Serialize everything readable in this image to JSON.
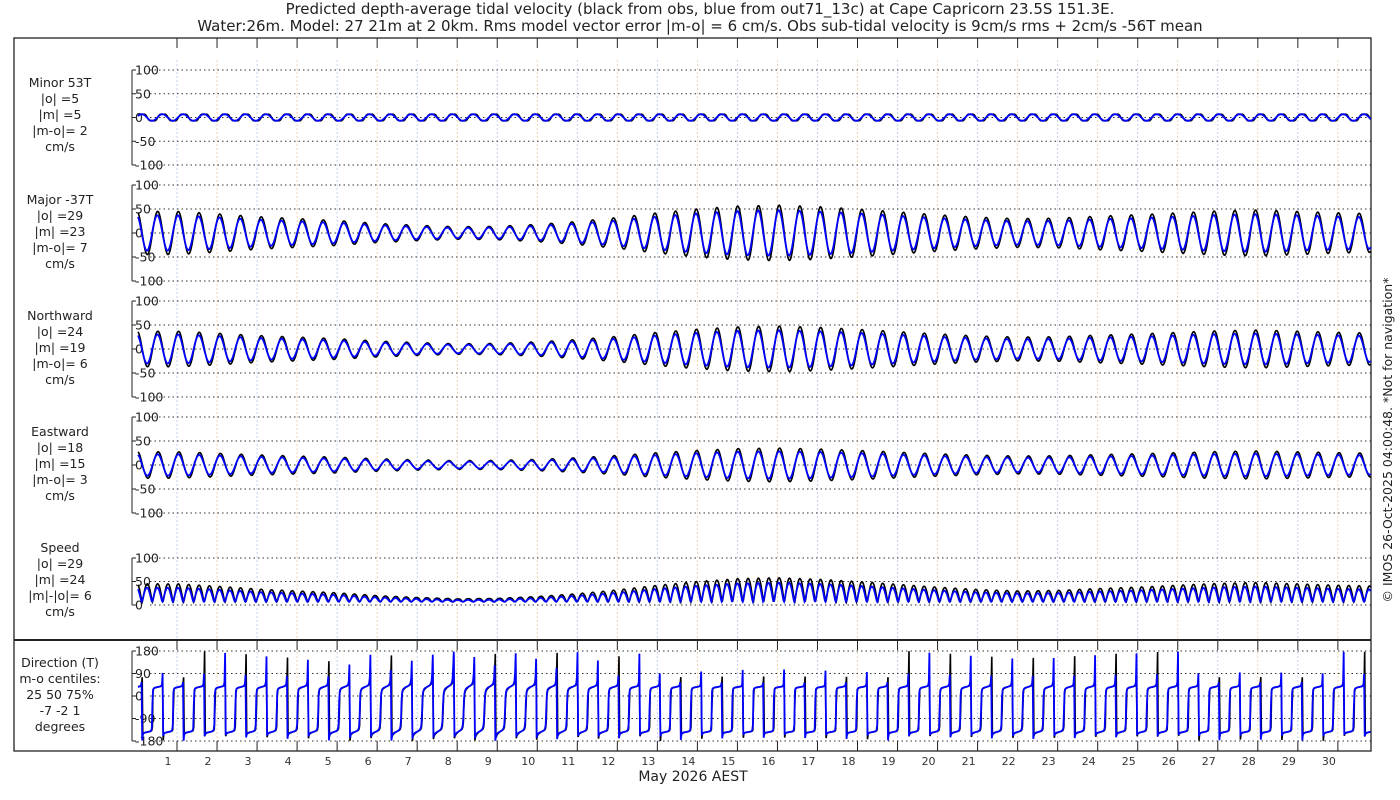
{
  "title": {
    "line1": "Predicted depth-average tidal velocity (black from obs, blue from out71_13c) at Cape Capricorn 23.5S 151.3E.",
    "line2": "Water:26m. Model: 27 21m at 2 0km. Rms model vector error |m-o| = 6 cm/s. Obs sub-tidal velocity is 9cm/s rms + 2cm/s -56T mean"
  },
  "copyright": "© IMOS 26-Oct-2025 04:00:48. *Not for navigation*",
  "colors": {
    "obs": "#000000",
    "model": "#0000ff"
  },
  "chart_data": {
    "type": "line",
    "xlabel": "May 2026 AEST",
    "x_ticks": [
      "1",
      "2",
      "3",
      "4",
      "5",
      "6",
      "7",
      "8",
      "9",
      "10",
      "11",
      "12",
      "13",
      "14",
      "15",
      "16",
      "17",
      "18",
      "19",
      "20",
      "21",
      "22",
      "23",
      "24",
      "25",
      "26",
      "27",
      "28",
      "29",
      "30"
    ],
    "x_range_days": [
      0.03,
      31.85
    ],
    "grid": true,
    "legend": "in title: black from obs, blue from out71_13c",
    "major_amplitude_by_day": [
      45,
      45,
      40,
      34,
      30,
      26,
      20,
      16,
      13,
      14,
      18,
      24,
      32,
      42,
      50,
      56,
      58,
      55,
      50,
      44,
      38,
      33,
      30,
      31,
      35,
      38,
      42,
      46,
      48,
      45,
      42,
      40
    ],
    "model_to_obs_ratio": 0.82,
    "panels": [
      {
        "name": "minor",
        "label": [
          "Minor 53T",
          "|o| =5",
          "|m| =5",
          "|m-o|= 2",
          "cm/s"
        ],
        "yticks": [
          "100",
          "50",
          "0",
          "-50",
          "-100"
        ],
        "ylim": [
          -100,
          100
        ]
      },
      {
        "name": "major",
        "label": [
          "Major -37T",
          "|o| =29",
          "|m| =23",
          "|m-o|= 7",
          "cm/s"
        ],
        "yticks": [
          "100",
          "50",
          "0",
          "-50",
          "-100"
        ],
        "ylim": [
          -100,
          100
        ]
      },
      {
        "name": "northward",
        "label": [
          "Northward",
          "|o| =24",
          "|m| =19",
          "|m-o|= 6",
          "cm/s"
        ],
        "yticks": [
          "100",
          "50",
          "0",
          "-50",
          "-100"
        ],
        "ylim": [
          -100,
          100
        ]
      },
      {
        "name": "eastward",
        "label": [
          "Eastward",
          "|o| =18",
          "|m| =15",
          "|m-o|= 3",
          "cm/s"
        ],
        "yticks": [
          "100",
          "50",
          "0",
          "-50",
          "-100"
        ],
        "ylim": [
          -100,
          100
        ]
      },
      {
        "name": "speed",
        "label": [
          "Speed",
          "|o| =29",
          "|m| =24",
          "|m|-|o|= 6",
          "cm/s"
        ],
        "yticks": [
          "100",
          "50",
          "0"
        ],
        "ylim": [
          0,
          100
        ]
      },
      {
        "name": "direction",
        "label": [
          "Direction (T)",
          "m-o centiles:",
          "25  50  75%",
          "-7 -2  1",
          "degrees"
        ],
        "yticks": [
          "180",
          "90",
          "0",
          "-90",
          "-180"
        ],
        "ylim": [
          -180,
          180
        ]
      }
    ]
  }
}
